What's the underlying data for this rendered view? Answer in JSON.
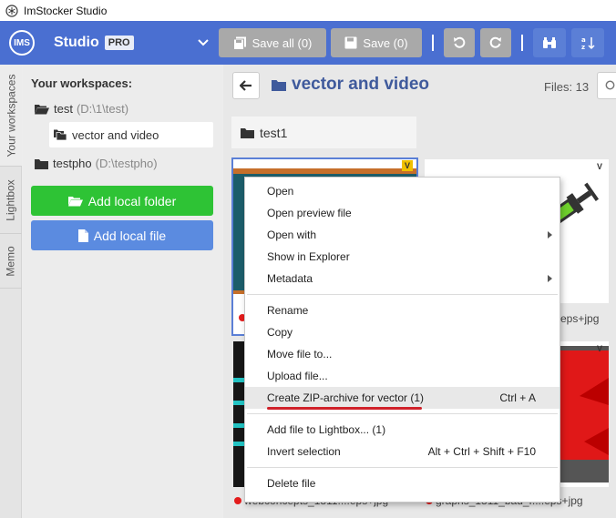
{
  "window": {
    "title": "ImStocker Studio"
  },
  "header": {
    "logo_text": "IMS",
    "product": "Studio",
    "badge": "PRO",
    "save_all_label": "Save all (0)",
    "save_label": "Save (0)"
  },
  "vtabs": [
    "Your workspaces",
    "Lightbox",
    "Memo"
  ],
  "sidebar": {
    "title": "Your workspaces:",
    "workspaces": [
      {
        "name": "test",
        "path": "(D:\\1\\test)"
      },
      {
        "name": "vector and video",
        "path": ""
      },
      {
        "name": "testpho",
        "path": "(D:\\testpho)"
      }
    ],
    "add_folder_label": "Add local folder",
    "add_file_label": "Add local file"
  },
  "main": {
    "breadcrumb": "vector and video",
    "files_count": "Files: 13",
    "subfolder": "test1",
    "thumbnails": [
      {
        "badge": "V"
      },
      {
        "badge": "V"
      },
      {
        "badge": ""
      },
      {
        "badge": "V"
      }
    ],
    "filenames": {
      "row1_right": "eps+jpg",
      "row2_left": "webconcepts_1811....eps+jpg",
      "row2_right": "graphs_1811_bad_f....eps+jpg"
    }
  },
  "context_menu": {
    "items": [
      {
        "label": "Open",
        "shortcut": ""
      },
      {
        "label": "Open preview file",
        "shortcut": ""
      },
      {
        "label": "Open with",
        "shortcut": ""
      },
      {
        "label": "Show in Explorer",
        "shortcut": ""
      },
      {
        "label": "Metadata",
        "shortcut": ""
      },
      {
        "label": "Rename",
        "shortcut": ""
      },
      {
        "label": "Copy",
        "shortcut": ""
      },
      {
        "label": "Move file to...",
        "shortcut": ""
      },
      {
        "label": "Upload file...",
        "shortcut": ""
      },
      {
        "label": "Create ZIP-archive for vector (1)",
        "shortcut": "Ctrl + A"
      },
      {
        "label": "Add file to Lightbox... (1)",
        "shortcut": ""
      },
      {
        "label": "Invert selection",
        "shortcut": "Alt + Ctrl + Shift + F10"
      },
      {
        "label": "Delete file",
        "shortcut": ""
      }
    ]
  },
  "colors": {
    "header": "#4a6fd1",
    "toolbar_button": "#a9a9a9",
    "add_folder": "#2ec335",
    "add_file": "#5b8be0",
    "highlight_underline": "#d0212a",
    "modified_dot": "#e31c1c"
  }
}
